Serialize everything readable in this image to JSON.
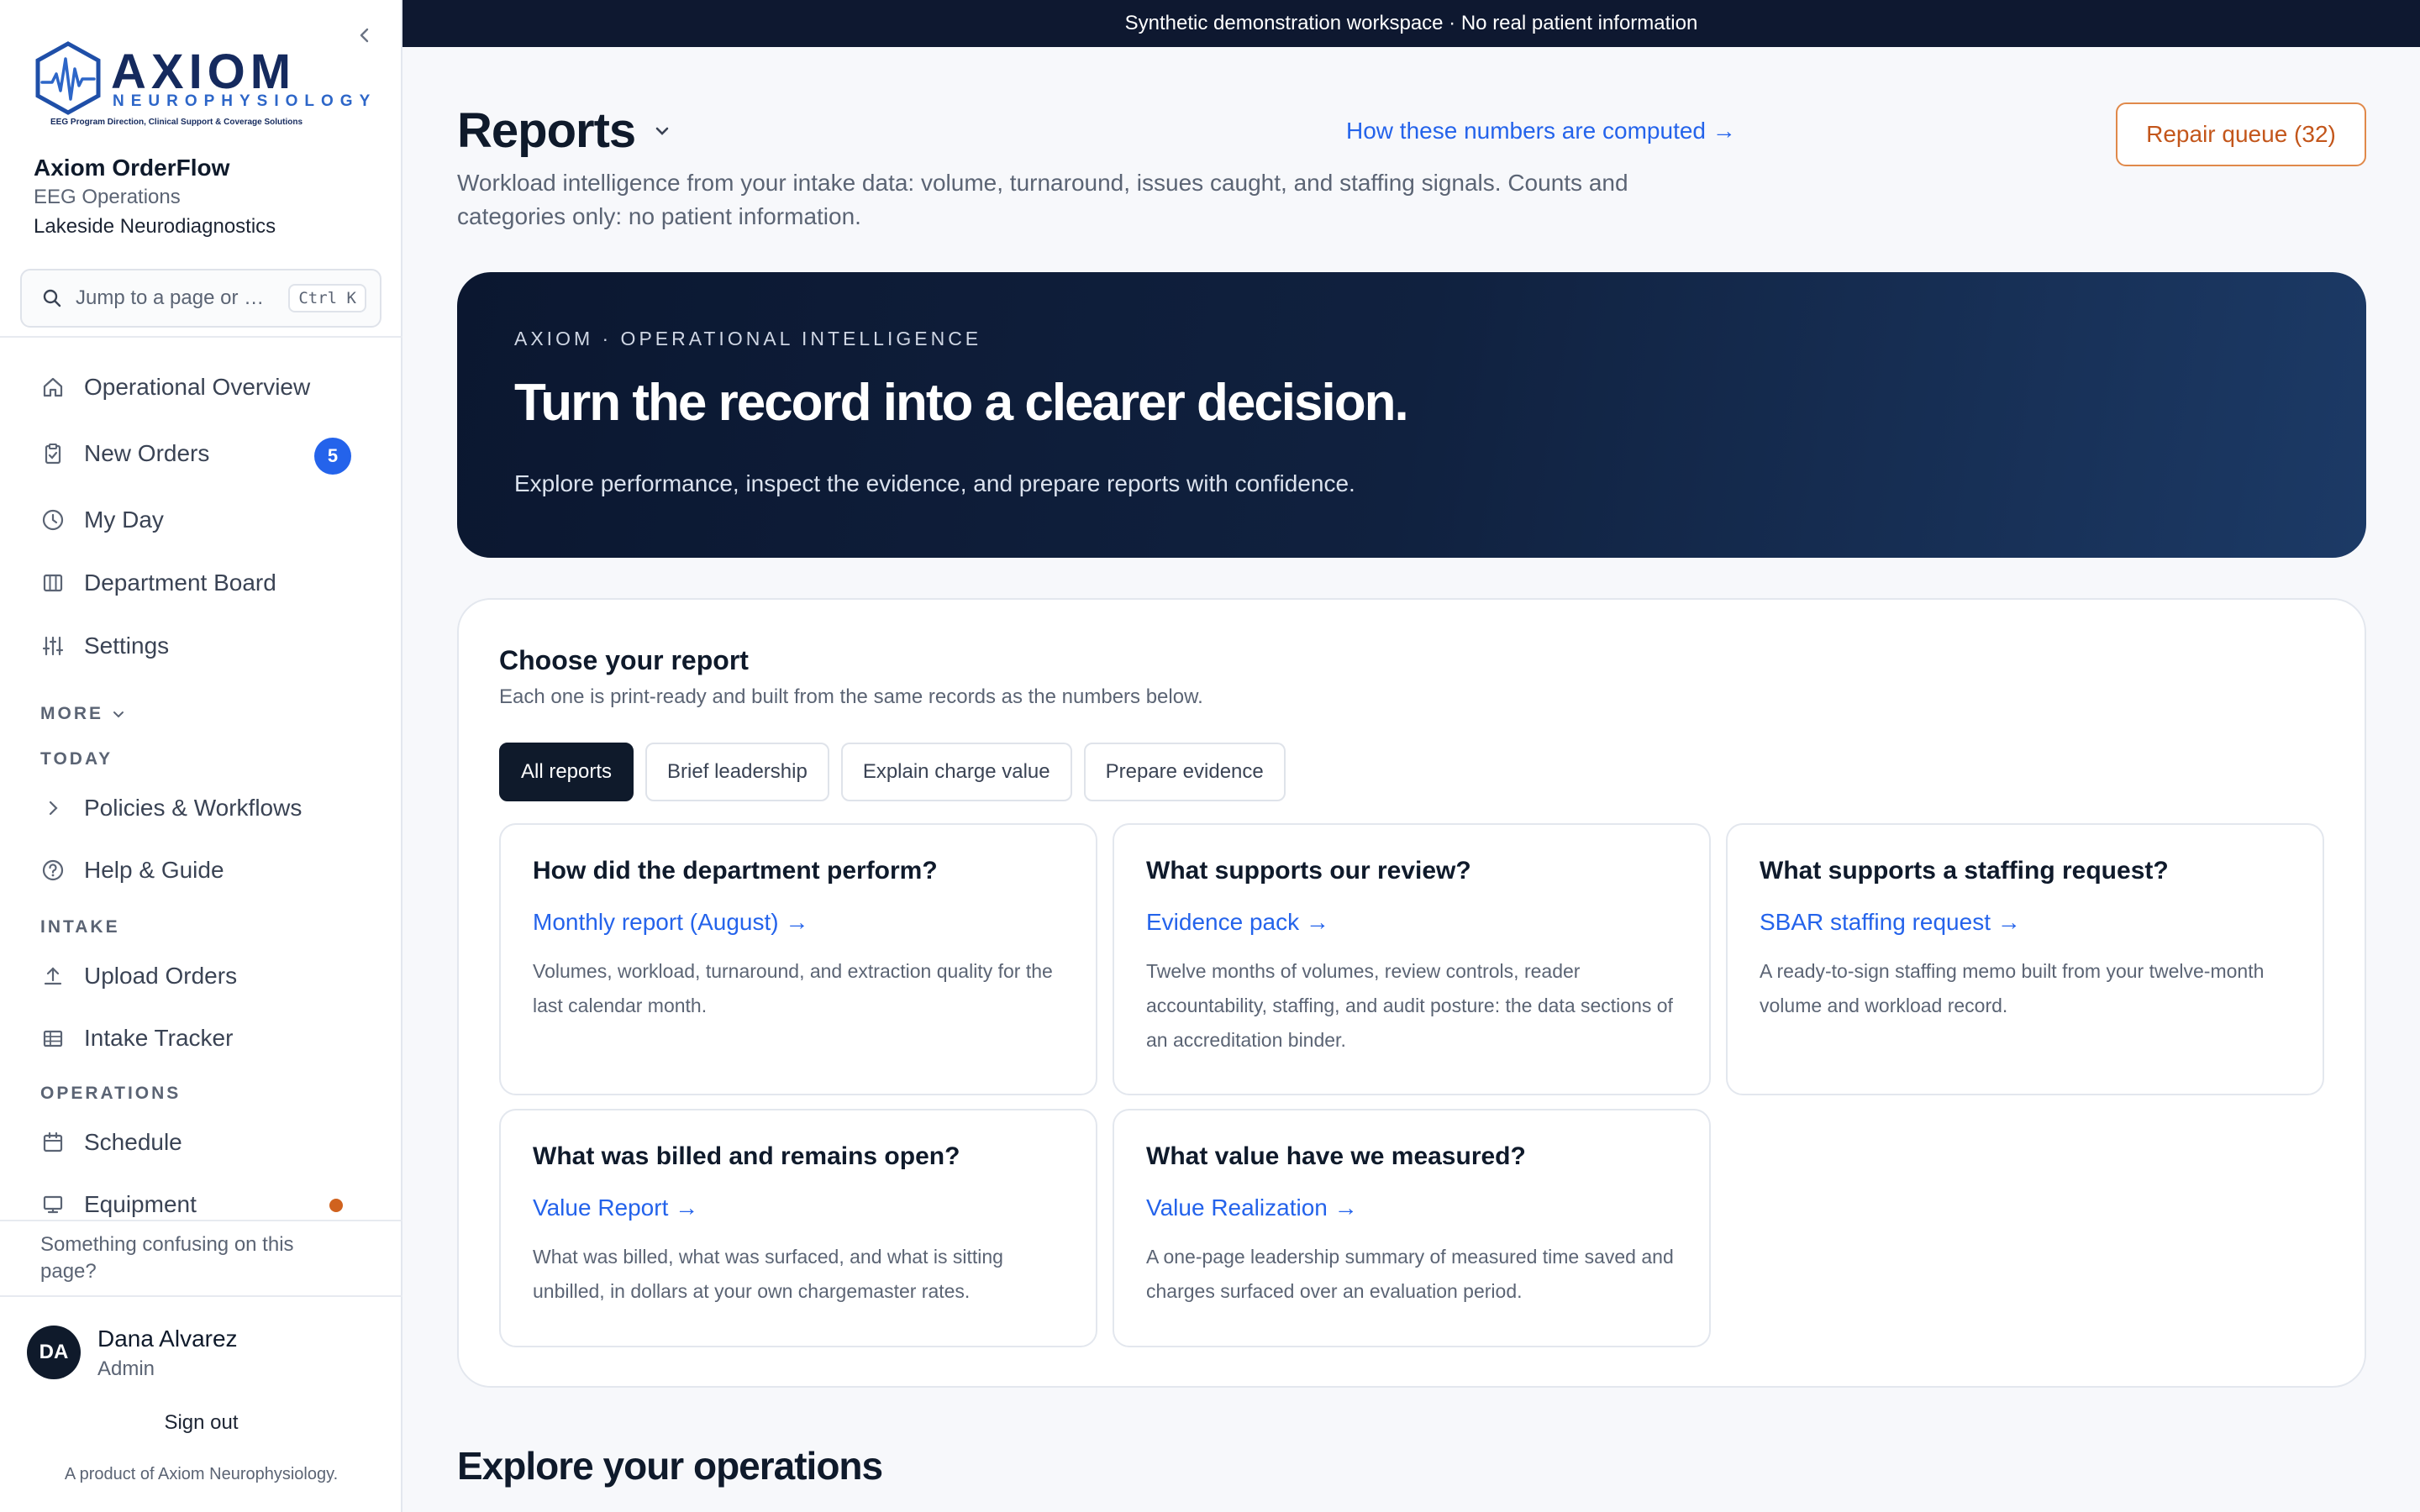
{
  "banner": "Synthetic demonstration workspace · No real patient information",
  "brand": {
    "wordmark": "AXIOM",
    "sub": "NEUROPHYSIOLOGY",
    "tagline": "EEG Program Direction, Clinical Support & Coverage Solutions",
    "app": "Axiom OrderFlow",
    "department": "EEG Operations",
    "site": "Lakeside Neurodiagnostics"
  },
  "search": {
    "placeholder": "Jump to a page or o...",
    "shortcut": "Ctrl K"
  },
  "nav": {
    "overview": "Operational Overview",
    "new_orders": "New Orders",
    "new_orders_count": "5",
    "my_day": "My Day",
    "department_board": "Department Board",
    "settings": "Settings",
    "more": "MORE",
    "today": "TODAY",
    "policies": "Policies & Workflows",
    "help": "Help & Guide",
    "intake": "INTAKE",
    "upload": "Upload Orders",
    "tracker": "Intake Tracker",
    "operations": "OPERATIONS",
    "schedule": "Schedule",
    "equipment": "Equipment"
  },
  "feedback": "Something confusing on this page?",
  "user": {
    "initials": "DA",
    "name": "Dana Alvarez",
    "role": "Admin"
  },
  "signout": "Sign out",
  "product": "A product of Axiom Neurophysiology.",
  "header": {
    "title": "Reports",
    "how_link": "How these numbers are computed →",
    "repair_button": "Repair queue (32)",
    "description": "Workload intelligence from your intake data: volume, turnaround, issues caught, and staffing signals. Counts and categories only: no patient information."
  },
  "hero": {
    "kicker": "AXIOM · OPERATIONAL INTELLIGENCE",
    "title": "Turn the record into a clearer decision.",
    "subtitle": "Explore performance, inspect the evidence, and prepare reports with confidence."
  },
  "chooser": {
    "title": "Choose your report",
    "subtitle": "Each one is print-ready and built from the same records as the numbers below.",
    "tabs": [
      "All reports",
      "Brief leadership",
      "Explain charge value",
      "Prepare evidence"
    ],
    "cards": [
      {
        "question": "How did the department perform?",
        "link": "Monthly report (August) →",
        "description": "Volumes, workload, turnaround, and extraction quality for the last calendar month."
      },
      {
        "question": "What supports our review?",
        "link": "Evidence pack →",
        "description": "Twelve months of volumes, review controls, reader accountability, staffing, and audit posture: the data sections of an accreditation binder."
      },
      {
        "question": "What supports a staffing request?",
        "link": "SBAR staffing request →",
        "description": "A ready-to-sign staffing memo built from your twelve-month volume and workload record."
      },
      {
        "question": "What was billed and remains open?",
        "link": "Value Report →",
        "description": "What was billed, what was surfaced, and what is sitting unbilled, in dollars at your own chargemaster rates."
      },
      {
        "question": "What value have we measured?",
        "link": "Value Realization →",
        "description": "A one-page leadership summary of measured time saved and charges surfaced over an evaluation period."
      }
    ]
  },
  "explore_heading": "Explore your operations"
}
